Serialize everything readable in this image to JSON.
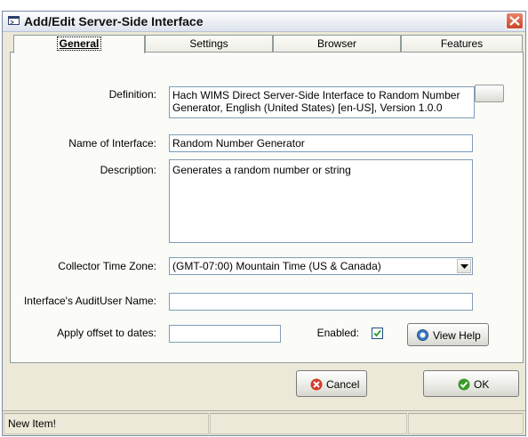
{
  "window": {
    "title": "Add/Edit Server-Side Interface"
  },
  "tabs": [
    {
      "label": "General",
      "active": true
    },
    {
      "label": "Settings",
      "active": false
    },
    {
      "label": "Browser",
      "active": false
    },
    {
      "label": "Features",
      "active": false
    }
  ],
  "form": {
    "definition_label": "Definition:",
    "definition_value": "Hach WIMS Direct Server-Side Interface to Random Number Generator, English (United States) [en-US], Version 1.0.0",
    "name_label": "Name of Interface:",
    "name_value": "Random Number Generator",
    "description_label": "Description:",
    "description_value": "Generates a random number or string",
    "timezone_label": "Collector Time Zone:",
    "timezone_value": "(GMT-07:00) Mountain Time (US & Canada)",
    "audituser_label": "Interface's AuditUser Name:",
    "audituser_value": "",
    "offset_label": "Apply offset to dates:",
    "offset_value": "",
    "enabled_label": "Enabled:",
    "enabled_checked": true,
    "view_help_label": "View Help"
  },
  "buttons": {
    "cancel_label": "Cancel",
    "ok_label": "OK"
  },
  "status": {
    "text": "New Item!",
    "cell2": "",
    "cell3": ""
  },
  "colors": {
    "close_button": "#c9462a",
    "cancel_icon": "#d43a2a",
    "ok_icon": "#3a9a2a",
    "help_icon": "#3a7ac8"
  }
}
